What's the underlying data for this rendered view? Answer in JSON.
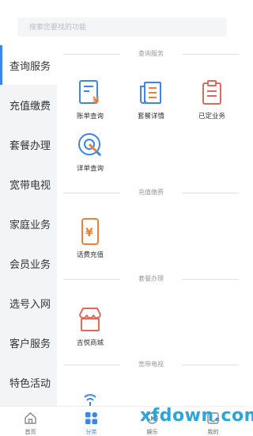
{
  "search": {
    "placeholder": "搜索您要找的功能"
  },
  "sidebar": {
    "items": [
      {
        "label": "查询服务",
        "active": true
      },
      {
        "label": "充值缴费"
      },
      {
        "label": "套餐办理"
      },
      {
        "label": "宽带电视"
      },
      {
        "label": "家庭业务"
      },
      {
        "label": "会员业务"
      },
      {
        "label": "选号入网"
      },
      {
        "label": "客户服务"
      },
      {
        "label": "特色活动"
      }
    ]
  },
  "sections": {
    "query": {
      "title": "查询服务",
      "tiles": [
        {
          "label": "账单查询",
          "icon": "bill-icon"
        },
        {
          "label": "套餐详情",
          "icon": "package-detail-icon"
        },
        {
          "label": "已定业务",
          "icon": "ordered-business-icon"
        },
        {
          "label": "详单查询",
          "icon": "detail-search-icon"
        }
      ]
    },
    "recharge": {
      "title": "充值缴费",
      "tiles": [
        {
          "label": "话费充值",
          "icon": "phone-recharge-icon"
        }
      ]
    },
    "package": {
      "title": "套餐办理",
      "tiles": [
        {
          "label": "吉悦商城",
          "icon": "shop-icon"
        }
      ]
    },
    "broadband": {
      "title": "宽带电视"
    }
  },
  "bottom_nav": {
    "items": [
      {
        "label": "首页",
        "icon": "home-icon"
      },
      {
        "label": "分类",
        "icon": "category-icon",
        "active": true
      },
      {
        "label": "娱乐",
        "icon": "entertainment-icon"
      },
      {
        "label": "我的",
        "icon": "profile-icon"
      }
    ]
  },
  "watermark": {
    "text": "xfdown.com"
  },
  "colors": {
    "accent": "#3b86e8",
    "orange": "#e8823a",
    "red": "#e06a5a"
  }
}
